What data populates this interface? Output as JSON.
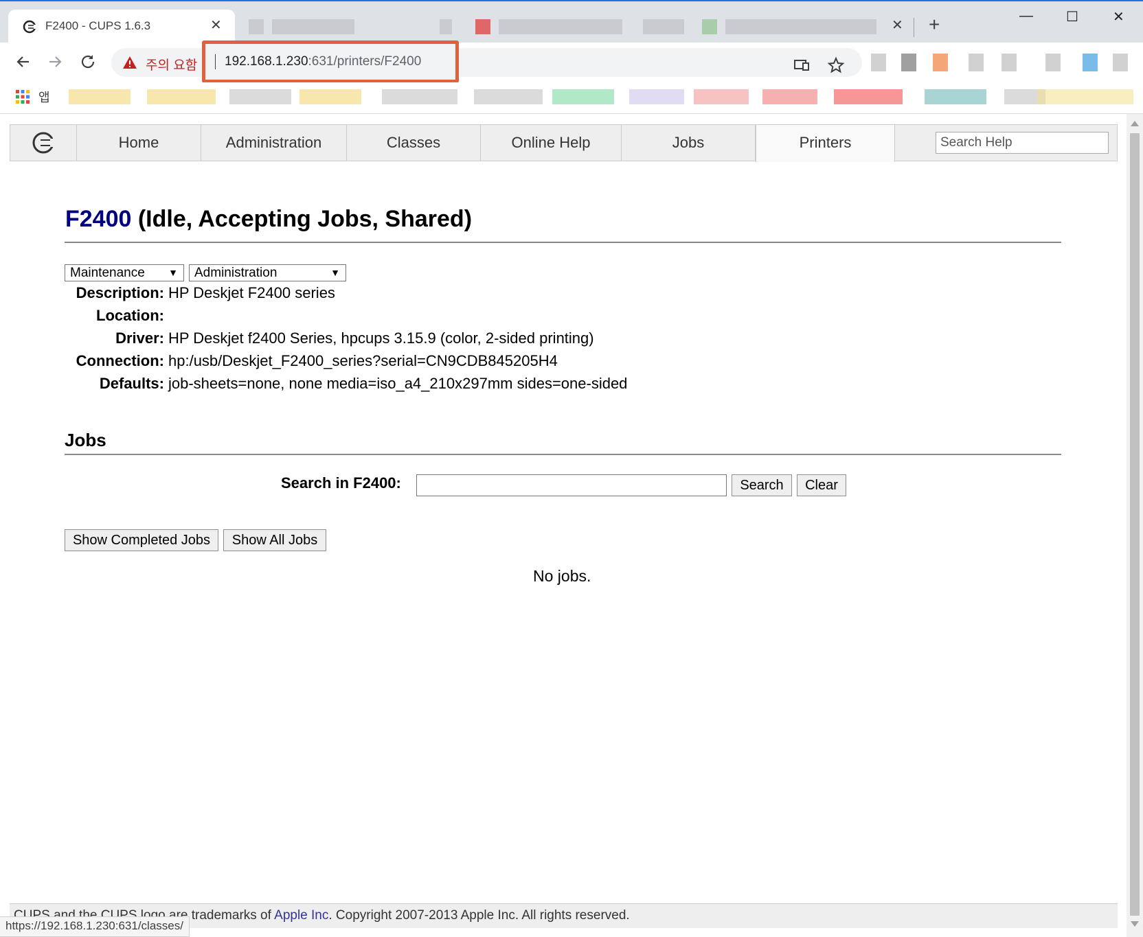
{
  "browser": {
    "tab_title": "F2400 - CUPS 1.6.3",
    "security_warning": "주의 요함",
    "url_host": "192.168.1.230",
    "url_rest": ":631/printers/F2400",
    "bookmarks_apps_label": "앱",
    "status_url": "https://192.168.1.230:631/classes/"
  },
  "nav": {
    "items": [
      "Home",
      "Administration",
      "Classes",
      "Online Help",
      "Jobs",
      "Printers"
    ],
    "selected": "Printers",
    "search_placeholder": "Search Help"
  },
  "printer": {
    "name": "F2400",
    "state": "(Idle, Accepting Jobs, Shared)",
    "maintenance_select": "Maintenance",
    "administration_select": "Administration",
    "properties": [
      {
        "label": "Description:",
        "value": "HP Deskjet F2400 series"
      },
      {
        "label": "Location:",
        "value": ""
      },
      {
        "label": "Driver:",
        "value": "HP Deskjet f2400 Series, hpcups 3.15.9 (color, 2-sided printing)"
      },
      {
        "label": "Connection:",
        "value": "hp:/usb/Deskjet_F2400_series?serial=CN9CDB845205H4"
      },
      {
        "label": "Defaults:",
        "value": "job-sheets=none, none media=iso_a4_210x297mm sides=one-sided"
      }
    ]
  },
  "jobs": {
    "heading": "Jobs",
    "search_label": "Search in F2400:",
    "search_button": "Search",
    "clear_button": "Clear",
    "show_completed_button": "Show Completed Jobs",
    "show_all_button": "Show All Jobs",
    "empty_text": "No jobs."
  },
  "footer": {
    "text_before": "CUPS and the CUPS logo are trademarks of ",
    "link": "Apple Inc",
    "text_after": ". Copyright 2007-2013 Apple Inc. All rights reserved."
  },
  "colors": {
    "accent_frame": "#e0603f",
    "printer_link": "#000080",
    "warning": "#c5221f"
  }
}
